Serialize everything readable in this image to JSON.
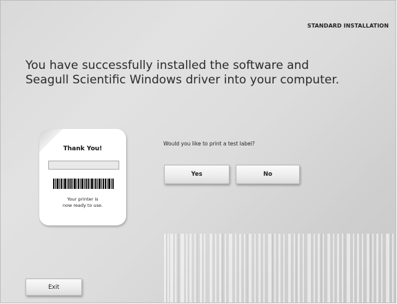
{
  "header": {
    "label": "STANDARD INSTALLATION"
  },
  "main": {
    "headline_line1": "You have successfully installed the  software and",
    "headline_line2": "Seagull Scientific Windows driver into your computer.",
    "question": "Would you like to print a test label?"
  },
  "label_card": {
    "title": "Thank You!",
    "message_line1": "Your printer is",
    "message_line2": "now ready to use."
  },
  "buttons": {
    "yes_label": "Yes",
    "no_label": "No",
    "exit_label": "Exit"
  },
  "icons": {
    "label_illustration": "thank-you-label-icon",
    "barcode": "barcode-icon",
    "decorative_barcode": "barcode-decoration"
  }
}
